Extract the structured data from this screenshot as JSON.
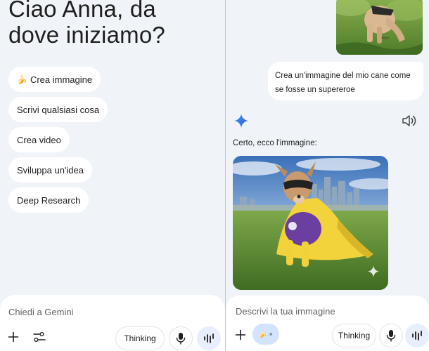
{
  "left": {
    "greeting_line1": "Ciao Anna, da",
    "greeting_line2": "dove iniziamo?",
    "chips": [
      {
        "label": "Crea immagine",
        "icon": "banana-emoji"
      },
      {
        "label": "Scrivi qualsiasi cosa"
      },
      {
        "label": "Crea video"
      },
      {
        "label": "Sviluppa un'idea"
      },
      {
        "label": "Deep Research"
      }
    ],
    "input": {
      "placeholder": "Chiedi a Gemini",
      "thinking_label": "Thinking"
    }
  },
  "right": {
    "user_message": "Crea un'immagine del mio cane come se fosse un supereroe",
    "response_text": "Certo, ecco l'immagine:",
    "input": {
      "placeholder": "Descrivi la tua immagine",
      "thinking_label": "Thinking",
      "attach_chip_close": "×"
    }
  },
  "colors": {
    "background": "#f0f4f9",
    "surface": "#ffffff",
    "gemini_blue": "#4285f4",
    "attach_chip": "#d3e3fd",
    "live_button": "#e8eefb"
  }
}
